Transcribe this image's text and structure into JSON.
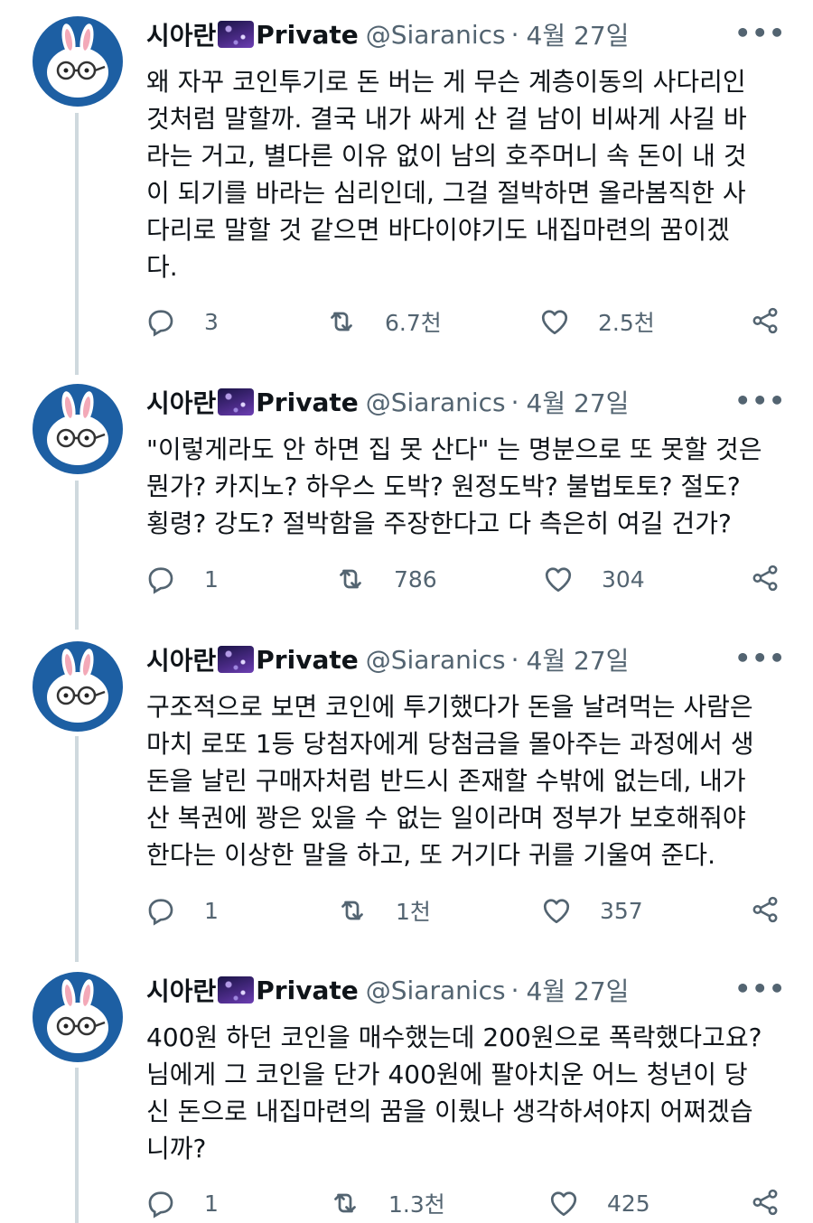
{
  "tweets": [
    {
      "display_name": "시아란",
      "badge_label": "Private",
      "handle": "@Siaranics",
      "separator": "·",
      "date": "4월 27일",
      "text": "왜 자꾸 코인투기로 돈 버는 게 무슨 계층이동의 사다리인\n것처럼 말할까. 결국 내가 싸게 산 걸 남이 비싸게 사길 바\n라는 거고, 별다른 이유 없이 남의 호주머니 속 돈이 내 것\n이 되기를 바라는 심리인데, 그걸 절박하면 올라봄직한 사\n다리로 말할 것 같으면 바다이야기도 내집마련의 꿈이겠\n다.",
      "replies": "3",
      "retweets": "6.7천",
      "likes": "2.5천"
    },
    {
      "display_name": "시아란",
      "badge_label": "Private",
      "handle": "@Siaranics",
      "separator": "·",
      "date": "4월 27일",
      "text": "\"이렇게라도 안 하면 집 못 산다\" 는 명분으로 또 못할 것은\n뭔가? 카지노? 하우스 도박? 원정도박? 불법토토? 절도?\n횡령? 강도? 절박함을 주장한다고 다 측은히 여길 건가?",
      "replies": "1",
      "retweets": "786",
      "likes": "304"
    },
    {
      "display_name": "시아란",
      "badge_label": "Private",
      "handle": "@Siaranics",
      "separator": "·",
      "date": "4월 27일",
      "text": "구조적으로 보면 코인에 투기했다가 돈을 날려먹는 사람은\n마치 로또 1등 당첨자에게 당첨금을 몰아주는 과정에서 생\n돈을 날린 구매자처럼 반드시 존재할 수밖에 없는데, 내가\n산 복권에 꽝은 있을 수 없는 일이라며 정부가 보호해줘야\n한다는 이상한 말을 하고, 또 거기다 귀를 기울여 준다.",
      "replies": "1",
      "retweets": "1천",
      "likes": "357"
    },
    {
      "display_name": "시아란",
      "badge_label": "Private",
      "handle": "@Siaranics",
      "separator": "·",
      "date": "4월 27일",
      "text": "400원 하던 코인을 매수했는데 200원으로 폭락했다고요?\n님에게 그 코인을 단가 400원에 팔아치운 어느 청년이 당\n신 돈으로 내집마련의 꿈을 이뤘나 생각하셔야지 어쩌겠습\n니까?",
      "replies": "1",
      "retweets": "1.3천",
      "likes": "425"
    }
  ],
  "icons": {
    "reply": "reply-icon",
    "retweet": "retweet-icon",
    "like": "like-icon",
    "share": "share-icon",
    "more": "more-options-icon",
    "badge": "galaxy-emoji-icon"
  },
  "colors": {
    "secondary_text": "#536471",
    "thread_line": "#cfd9de",
    "avatar_bg": "#1d5fa3"
  }
}
